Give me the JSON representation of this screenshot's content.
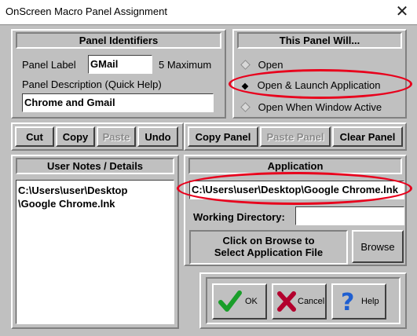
{
  "window": {
    "title": "OnScreen Macro Panel Assignment",
    "close_glyph": "✕"
  },
  "panel_identifiers": {
    "header": "Panel Identifiers",
    "label_caption": "Panel Label",
    "label_value": "GMail",
    "max_hint": "5 Maximum",
    "description_caption": "Panel Description (Quick Help)",
    "description_value": "Chrome and Gmail"
  },
  "this_panel_will": {
    "header": "This Panel Will...",
    "options": [
      {
        "label": "Open",
        "selected": false
      },
      {
        "label": "Open & Launch Application",
        "selected": true
      },
      {
        "label": "Open When Window Active",
        "selected": false
      }
    ]
  },
  "edit_buttons": {
    "cut": "Cut",
    "copy": "Copy",
    "paste": "Paste",
    "undo": "Undo"
  },
  "panel_buttons": {
    "copy_panel": "Copy Panel",
    "paste_panel": "Paste Panel",
    "clear_panel": "Clear Panel"
  },
  "user_notes": {
    "header": "User Notes / Details",
    "line1": "C:\\Users\\user\\Desktop",
    "line2": "\\Google Chrome.lnk"
  },
  "application": {
    "header": "Application",
    "path": "C:\\Users\\user\\Desktop\\Google Chrome.lnk",
    "working_dir_caption": "Working Directory:",
    "working_dir_value": "",
    "browse_hint_line1": "Click on Browse to",
    "browse_hint_line2": "Select Application File",
    "browse_button": "Browse"
  },
  "dialog_buttons": {
    "ok": "OK",
    "cancel": "Cancel",
    "help": "Help"
  },
  "colors": {
    "highlight_ellipse": "#e8001c",
    "ok_check": "#1a9e2a",
    "cancel_x": "#b3002d",
    "help_q": "#1f5fd1"
  }
}
